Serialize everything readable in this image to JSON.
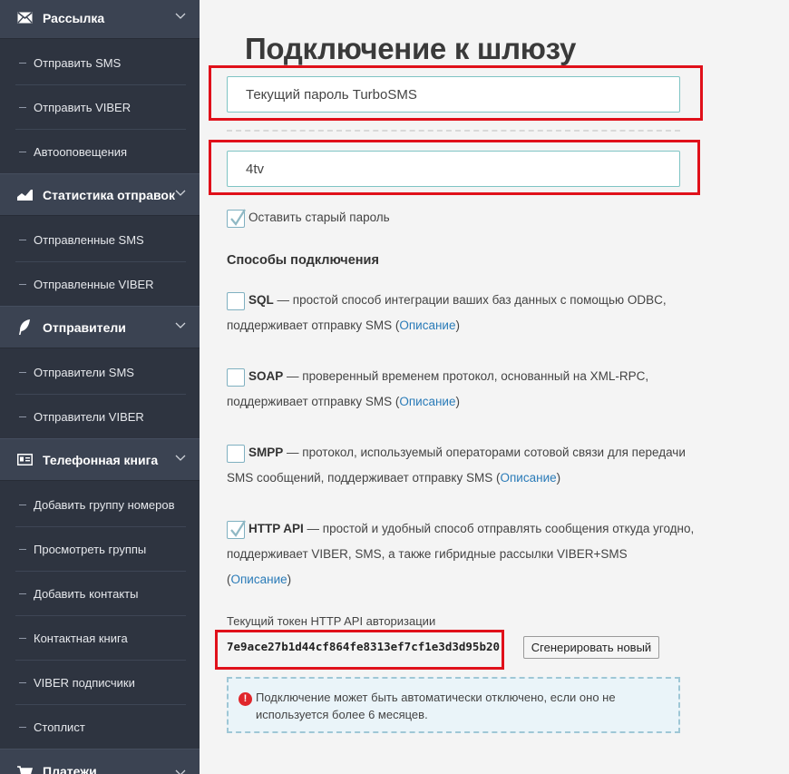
{
  "sidebar": {
    "sections": [
      {
        "label": "Рассылка",
        "icon": "envelope-icon",
        "items": [
          "Отправить SMS",
          "Отправить VIBER",
          "Автооповещения"
        ]
      },
      {
        "label": "Статистика отправок",
        "icon": "area-chart-icon",
        "items": [
          "Отправленные SMS",
          "Отправленные VIBER"
        ]
      },
      {
        "label": "Отправители",
        "icon": "feather-icon",
        "items": [
          "Отправители SMS",
          "Отправители VIBER"
        ]
      },
      {
        "label": "Телефонная книга",
        "icon": "contact-card-icon",
        "items": [
          "Добавить группу номеров",
          "Просмотреть группы",
          "Добавить контакты",
          "Контактная книга",
          "VIBER подписчики",
          "Стоплист"
        ]
      },
      {
        "label": "Платежи",
        "icon": "cart-icon",
        "items": []
      }
    ]
  },
  "main": {
    "title": "Подключение к шлюзу",
    "password_field": {
      "placeholder": "Текущий пароль TurboSMS"
    },
    "login_field": {
      "value": "4tv"
    },
    "keep_password": {
      "label": "Оставить старый пароль",
      "checked": true
    },
    "methods_heading": "Способы подключения",
    "methods": [
      {
        "name": "SQL",
        "line1": " — простой способ интеграции ваших баз данных с помощью ODBC,",
        "line2_pre": "поддерживает отправку SMS (",
        "link": "Описание",
        "line2_post": ")",
        "checked": false
      },
      {
        "name": "SOAP",
        "line1": " — проверенный временем протокол, основанный на XML-RPC,",
        "line2_pre": "поддерживает отправку SMS (",
        "link": "Описание",
        "line2_post": ")",
        "checked": false
      },
      {
        "name": "SMPP",
        "line1": " — протокол, используемый операторами сотовой связи для передачи",
        "line2_pre": "SMS сообщений, поддерживает отправку SMS (",
        "link": "Описание",
        "line2_post": ")",
        "checked": false
      },
      {
        "name": "HTTP API",
        "line1": " — простой и удобный способ отправлять сообщения откуда угодно,",
        "line2_pre": "поддерживает VIBER, SMS, а также гибридные рассылки VIBER+SMS",
        "line3_pre": "(",
        "link": "Описание",
        "line2_post": ")",
        "checked": true
      }
    ],
    "token_label": "Текущий токен HTTP API авторизации",
    "token_value": "7e9ace27b1d44cf864fe8313ef7cf1e3d3d95b20",
    "generate_button": "Сгенерировать новый",
    "notice": "Подключение может быть автоматически отключено, если оно не используется более 6 месяцев.",
    "notice_icon": "!"
  },
  "colors": {
    "sidebar_bg": "#2e3440",
    "link": "#2a7bb8",
    "highlight_box": "#e0101a",
    "input_border": "#7fc4c4"
  }
}
